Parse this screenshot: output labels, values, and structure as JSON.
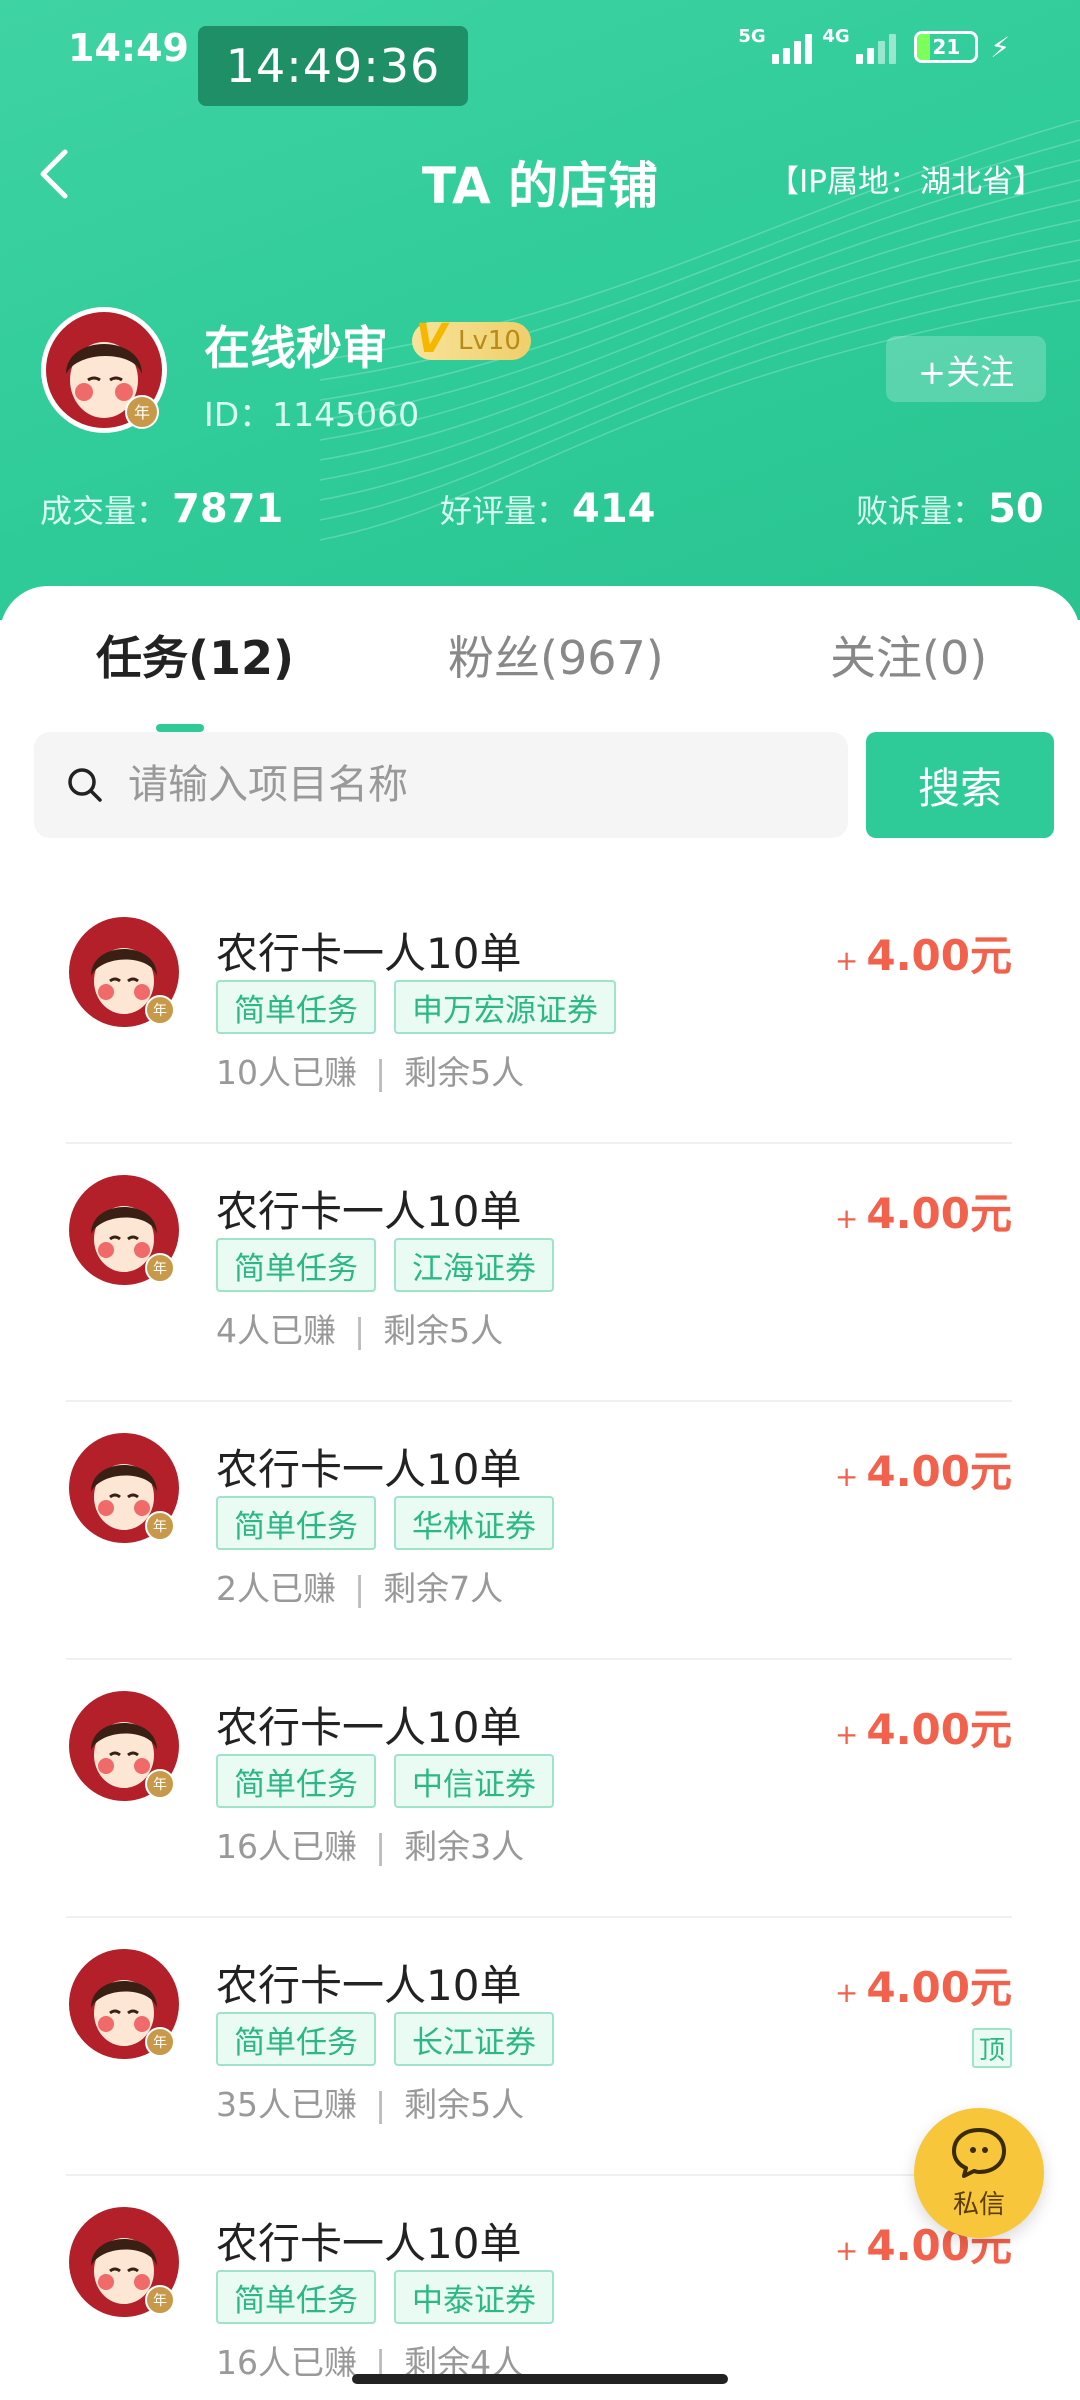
{
  "status_bar": {
    "time": "14:49",
    "clock": "14:49:36",
    "net1": "5G",
    "net2": "4G",
    "battery": "21"
  },
  "nav": {
    "title": "TA 的店铺",
    "ip_location": "【IP属地：湖北省】"
  },
  "profile": {
    "name": "在线秒审",
    "level": "Lv10",
    "level_prefix": "V",
    "id_label": "ID：1145060",
    "follow_label": "+关注",
    "avatar_badge": "年"
  },
  "stats": [
    {
      "label": "成交量：",
      "value": "7871"
    },
    {
      "label": "好评量：",
      "value": "414"
    },
    {
      "label": "败诉量：",
      "value": "50"
    }
  ],
  "tabs": [
    {
      "label": "任务(12)",
      "active": true
    },
    {
      "label": "粉丝(967)",
      "active": false
    },
    {
      "label": "关注(0)",
      "active": false
    }
  ],
  "search": {
    "placeholder": "请输入项目名称",
    "button_label": "搜索"
  },
  "tasks": [
    {
      "title": "农行卡一人10单",
      "tags": [
        "简单任务",
        "申万宏源证券"
      ],
      "earned": "10人已赚",
      "separator": "|",
      "remaining": "剩余5人",
      "plus": "+",
      "price": "4.00元",
      "pinned": ""
    },
    {
      "title": "农行卡一人10单",
      "tags": [
        "简单任务",
        "江海证券"
      ],
      "earned": "4人已赚",
      "separator": "|",
      "remaining": "剩余5人",
      "plus": "+",
      "price": "4.00元",
      "pinned": ""
    },
    {
      "title": "农行卡一人10单",
      "tags": [
        "简单任务",
        "华林证券"
      ],
      "earned": "2人已赚",
      "separator": "|",
      "remaining": "剩余7人",
      "plus": "+",
      "price": "4.00元",
      "pinned": ""
    },
    {
      "title": "农行卡一人10单",
      "tags": [
        "简单任务",
        "中信证券"
      ],
      "earned": "16人已赚",
      "separator": "|",
      "remaining": "剩余3人",
      "plus": "+",
      "price": "4.00元",
      "pinned": ""
    },
    {
      "title": "农行卡一人10单",
      "tags": [
        "简单任务",
        "长江证券"
      ],
      "earned": "35人已赚",
      "separator": "|",
      "remaining": "剩余5人",
      "plus": "+",
      "price": "4.00元",
      "pinned": "顶"
    },
    {
      "title": "农行卡一人10单",
      "tags": [
        "简单任务",
        "中泰证券"
      ],
      "earned": "16人已赚",
      "separator": "|",
      "remaining": "剩余4人",
      "plus": "+",
      "price": "4.00元",
      "pinned": ""
    }
  ],
  "fab": {
    "label": "私信"
  },
  "colors": {
    "brand_green": "#2ecb98",
    "price_red": "#f2614b",
    "fab_yellow": "#f7c63a"
  }
}
